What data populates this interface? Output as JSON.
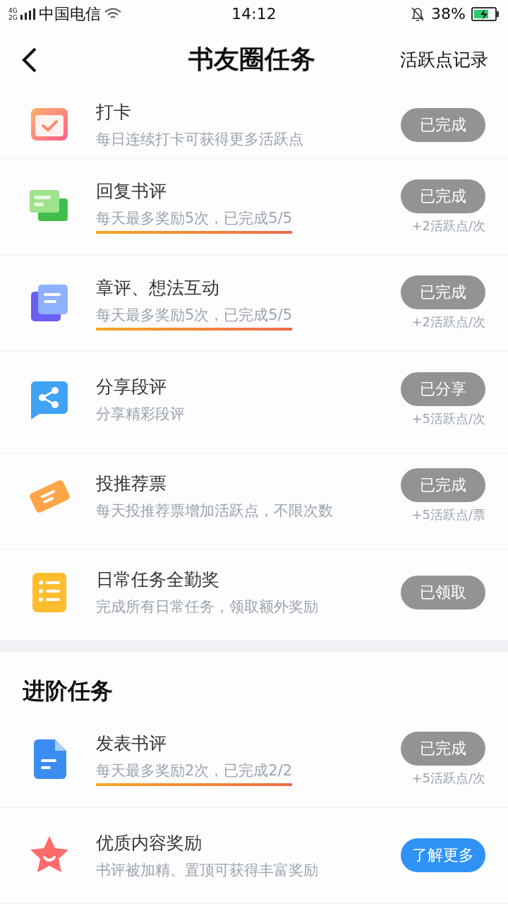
{
  "status_bar": {
    "network_top": "4G",
    "network_bottom": "2G",
    "carrier": "中国电信",
    "time": "14:12",
    "battery": "38%"
  },
  "nav": {
    "title": "书友圈任务",
    "action": "活跃点记录"
  },
  "daily_tasks": [
    {
      "kind": "calendar",
      "title": "打卡",
      "subtitle": "每日连续打卡可获得更多活跃点",
      "underlined": false,
      "button": {
        "label": "已完成",
        "kind": "done"
      }
    },
    {
      "kind": "chat",
      "title": "回复书评",
      "subtitle": "每天最多奖励5次，已完成5/5",
      "underlined": true,
      "button": {
        "label": "已完成",
        "kind": "done"
      },
      "reward": "+2活跃点/次"
    },
    {
      "kind": "notes",
      "title": "章评、想法互动",
      "subtitle": "每天最多奖励5次，已完成5/5",
      "underlined": true,
      "button": {
        "label": "已完成",
        "kind": "done"
      },
      "reward": "+2活跃点/次"
    },
    {
      "kind": "share",
      "title": "分享段评",
      "subtitle": "分享精彩段评",
      "underlined": false,
      "button": {
        "label": "已分享",
        "kind": "done"
      },
      "reward": "+5活跃点/次"
    },
    {
      "kind": "ticket",
      "title": "投推荐票",
      "subtitle": "每天投推荐票增加活跃点，不限次数",
      "underlined": false,
      "button": {
        "label": "已完成",
        "kind": "done"
      },
      "reward": "+5活跃点/票"
    },
    {
      "kind": "list",
      "title": "日常任务全勤奖",
      "subtitle": "完成所有日常任务，领取额外奖励",
      "underlined": false,
      "button": {
        "label": "已领取",
        "kind": "done"
      }
    }
  ],
  "advanced_section": {
    "title": "进阶任务",
    "tasks": [
      {
        "kind": "document",
        "title": "发表书评",
        "subtitle": "每天最多奖励2次，已完成2/2",
        "underlined": true,
        "button": {
          "label": "已完成",
          "kind": "done"
        },
        "reward": "+5活跃点/次"
      },
      {
        "kind": "star",
        "title": "优质内容奖励",
        "subtitle": "书评被加精、置顶可获得丰富奖励",
        "underlined": false,
        "button": {
          "label": "了解更多",
          "kind": "primary"
        }
      }
    ]
  }
}
